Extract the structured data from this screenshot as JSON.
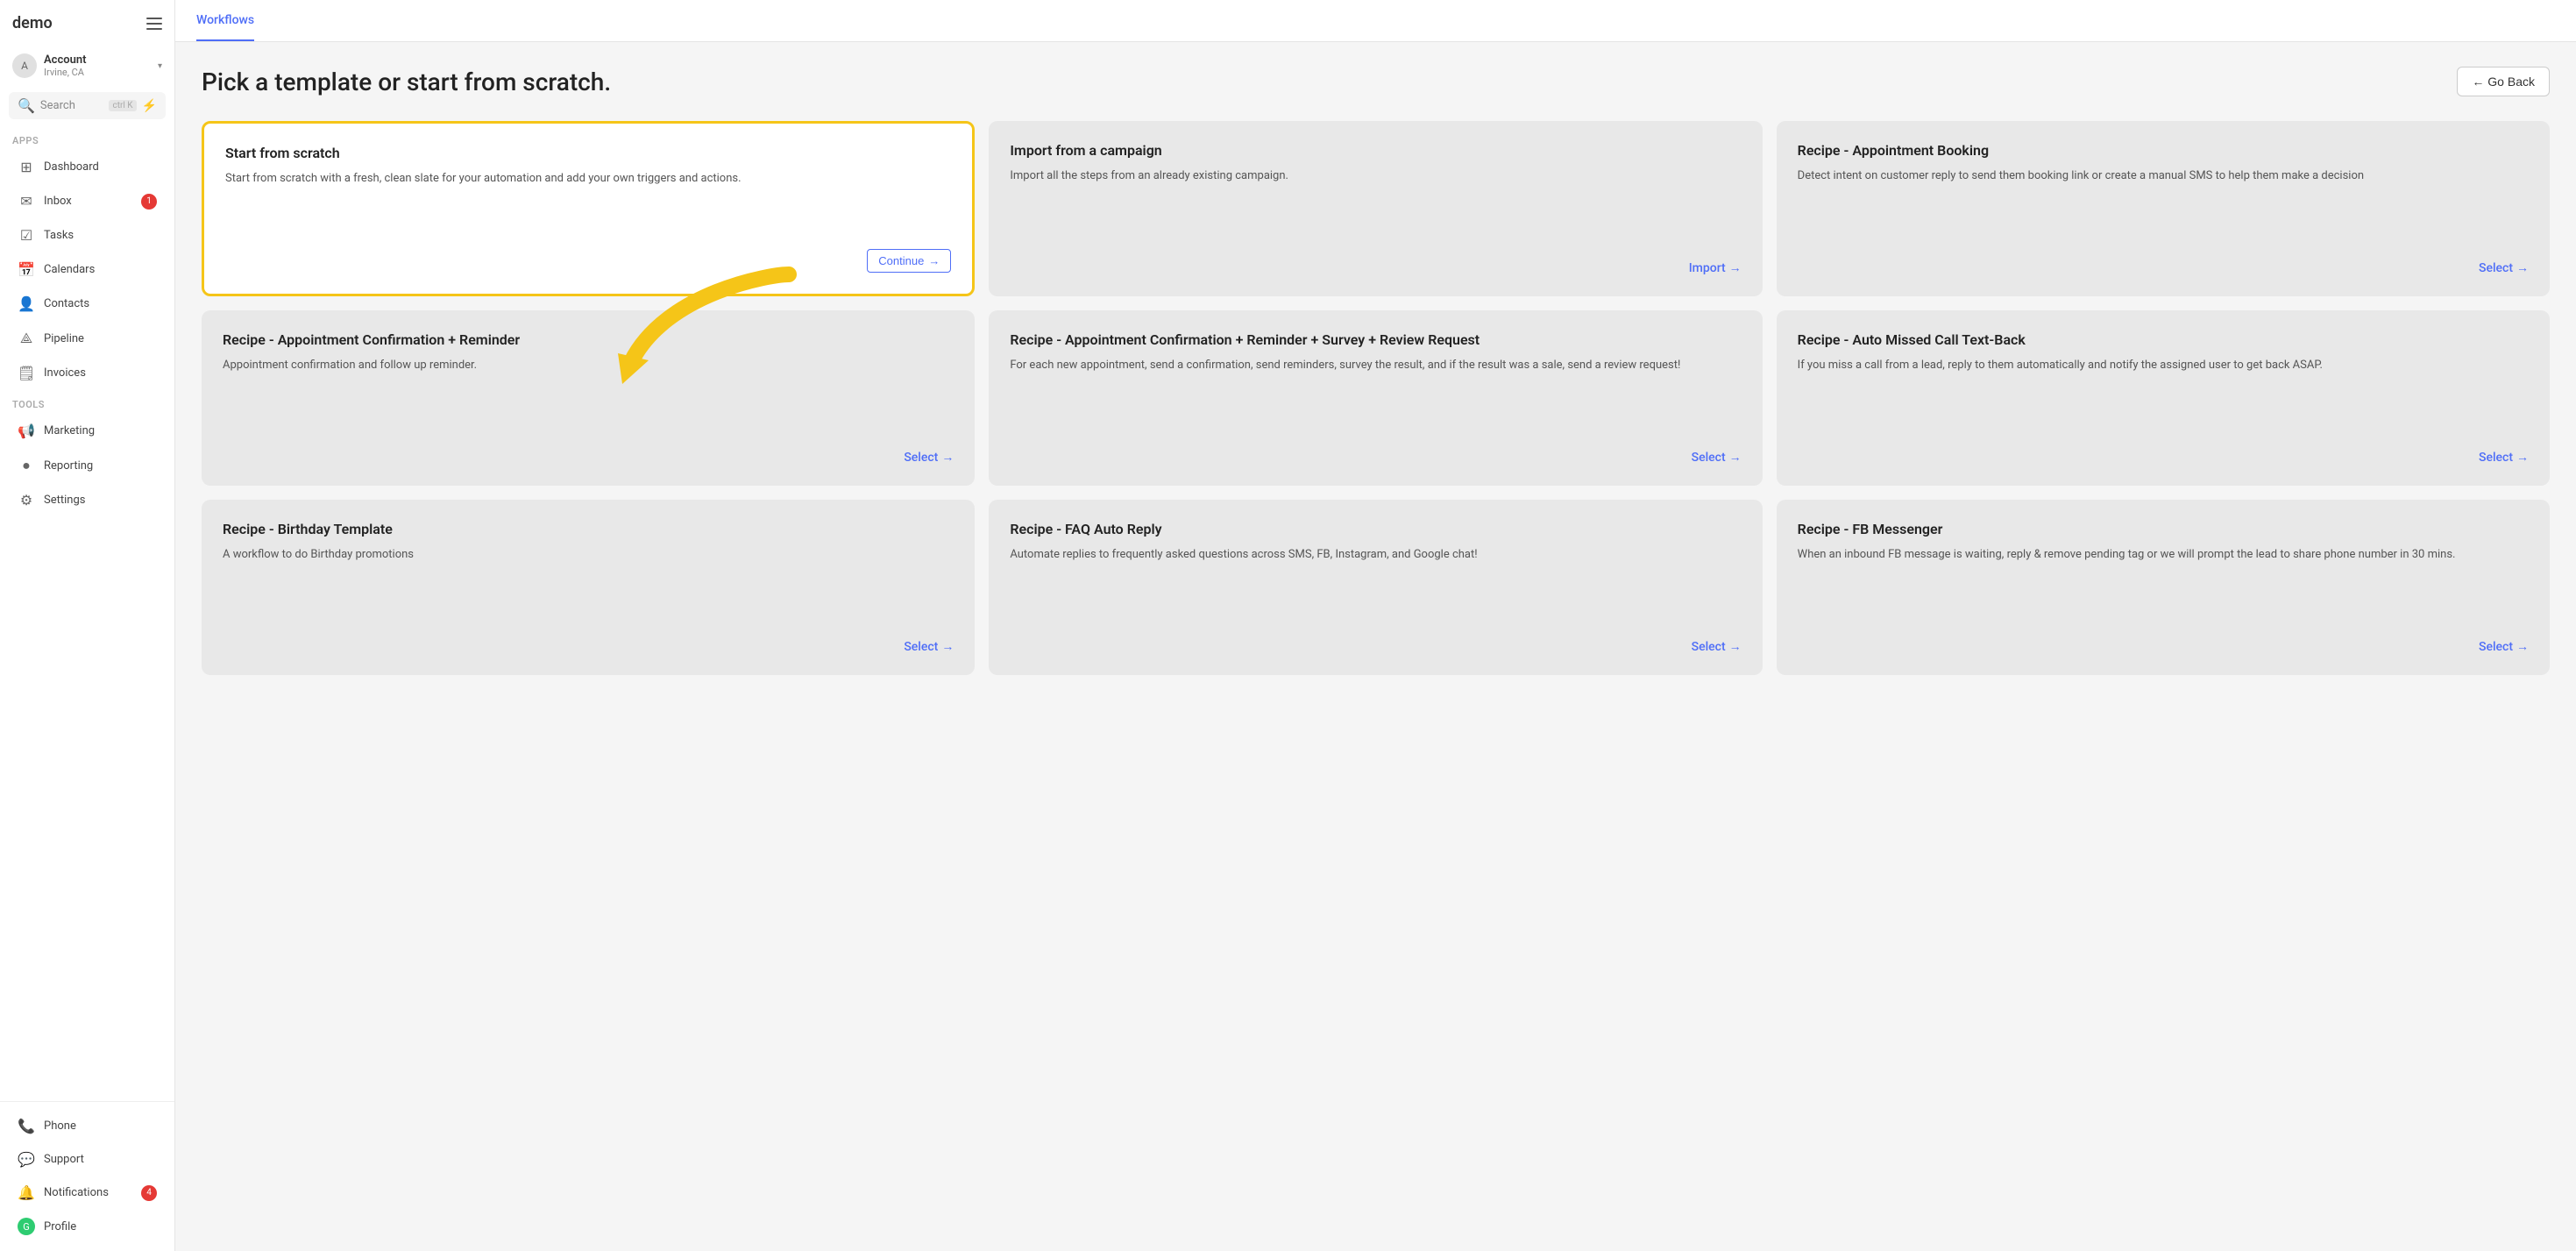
{
  "app": {
    "logo": "demo",
    "hamburger_label": "menu"
  },
  "account": {
    "name": "Account",
    "location": "Irvine, CA",
    "avatar_initial": "A"
  },
  "search": {
    "placeholder": "Search",
    "shortcut": "ctrl K",
    "lightning_icon": "⚡"
  },
  "sidebar": {
    "apps_label": "Apps",
    "tools_label": "Tools",
    "nav_items": [
      {
        "id": "dashboard",
        "label": "Dashboard",
        "icon": "⊞",
        "badge": null
      },
      {
        "id": "inbox",
        "label": "Inbox",
        "icon": "✉",
        "badge": "1"
      },
      {
        "id": "tasks",
        "label": "Tasks",
        "icon": "☑",
        "badge": null
      },
      {
        "id": "calendars",
        "label": "Calendars",
        "icon": "📅",
        "badge": null
      },
      {
        "id": "contacts",
        "label": "Contacts",
        "icon": "👤",
        "badge": null
      },
      {
        "id": "pipeline",
        "label": "Pipeline",
        "icon": "⟁",
        "badge": null
      },
      {
        "id": "invoices",
        "label": "Invoices",
        "icon": "🗒",
        "badge": null
      }
    ],
    "tools_items": [
      {
        "id": "marketing",
        "label": "Marketing",
        "icon": "📢",
        "badge": null
      },
      {
        "id": "reporting",
        "label": "Reporting",
        "icon": "●",
        "badge": null
      },
      {
        "id": "settings",
        "label": "Settings",
        "icon": "⚙",
        "badge": null
      }
    ],
    "bottom_items": [
      {
        "id": "phone",
        "label": "Phone",
        "icon": "📞",
        "badge": null
      },
      {
        "id": "support",
        "label": "Support",
        "icon": "💬",
        "badge": null
      },
      {
        "id": "notifications",
        "label": "Notifications",
        "icon": "🔔",
        "badge": "4"
      },
      {
        "id": "profile",
        "label": "Profile",
        "icon": "G",
        "badge": null
      }
    ]
  },
  "header": {
    "tab": "Workflows",
    "back_button": "← Go Back"
  },
  "page": {
    "title": "Pick a template or start from scratch."
  },
  "templates": [
    {
      "id": "start-from-scratch",
      "title": "Start from scratch",
      "description": "Start from scratch with a fresh, clean slate for your automation and add your own triggers and actions.",
      "action_label": "Continue",
      "action_arrow": "→",
      "highlighted": true,
      "action_type": "continue"
    },
    {
      "id": "import-from-campaign",
      "title": "Import from a campaign",
      "description": "Import all the steps from an already existing campaign.",
      "action_label": "Import",
      "action_arrow": "→",
      "highlighted": false,
      "action_type": "link"
    },
    {
      "id": "recipe-appointment-booking",
      "title": "Recipe - Appointment Booking",
      "description": "Detect intent on customer reply to send them booking link or create a manual SMS to help them make a decision",
      "action_label": "Select",
      "action_arrow": "→",
      "highlighted": false,
      "action_type": "link"
    },
    {
      "id": "recipe-appointment-confirmation-reminder",
      "title": "Recipe - Appointment Confirmation + Reminder",
      "description": "Appointment confirmation and follow up reminder.",
      "action_label": "Select",
      "action_arrow": "→",
      "highlighted": false,
      "action_type": "link"
    },
    {
      "id": "recipe-appointment-confirmation-reminder-survey",
      "title": "Recipe - Appointment Confirmation + Reminder + Survey + Review Request",
      "description": "For each new appointment, send a confirmation, send reminders, survey the result, and if the result was a sale, send a review request!",
      "action_label": "Select",
      "action_arrow": "→",
      "highlighted": false,
      "action_type": "link"
    },
    {
      "id": "recipe-auto-missed-call",
      "title": "Recipe - Auto Missed Call Text-Back",
      "description": "If you miss a call from a lead, reply to them automatically and notify the assigned user to get back ASAP.",
      "action_label": "Select",
      "action_arrow": "→",
      "highlighted": false,
      "action_type": "link"
    },
    {
      "id": "recipe-birthday-template",
      "title": "Recipe - Birthday Template",
      "description": "A workflow to do Birthday promotions",
      "action_label": "Select",
      "action_arrow": "→",
      "highlighted": false,
      "action_type": "link"
    },
    {
      "id": "recipe-faq-auto-reply",
      "title": "Recipe - FAQ Auto Reply",
      "description": "Automate replies to frequently asked questions across SMS, FB, Instagram, and Google chat!",
      "action_label": "Select",
      "action_arrow": "→",
      "highlighted": false,
      "action_type": "link"
    },
    {
      "id": "recipe-fb-messenger",
      "title": "Recipe - FB Messenger",
      "description": "When an inbound FB message is waiting, reply & remove pending tag or we will prompt the lead to share phone number in 30 mins.",
      "action_label": "Select",
      "action_arrow": "→",
      "highlighted": false,
      "action_type": "link"
    }
  ]
}
